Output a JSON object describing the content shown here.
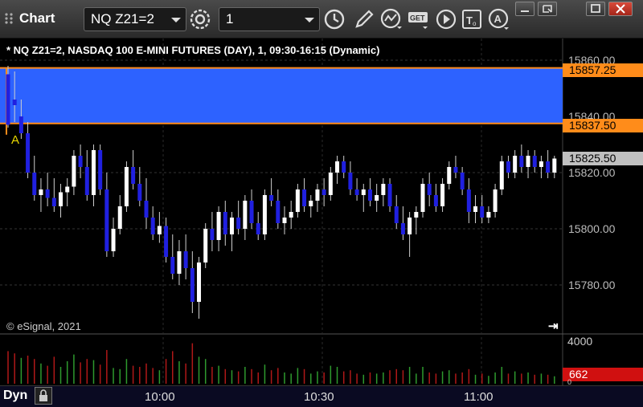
{
  "app": {
    "title": "Chart"
  },
  "toolbar": {
    "symbol": "NQ Z21=2",
    "interval": "1",
    "icons": [
      "settings-gear-icon",
      "clock-icon",
      "pencil-icon",
      "study-icon",
      "get-icon",
      "play-icon",
      "text-tool-icon",
      "alert-icon"
    ],
    "get_label": "GET"
  },
  "chart": {
    "header": "* NQ Z21=2, NASDAQ 100 E-MINI FUTURES (DAY), 1, 09:30-16:15 (Dynamic)",
    "watermark": "© eSignal, 2021",
    "marker_label": "A",
    "price_axis": [
      "15860.00",
      "15840.00",
      "15820.00",
      "15800.00",
      "15780.00"
    ],
    "zone_upper": "15857.25",
    "zone_lower": "15837.50",
    "last_price": "15825.50",
    "volume_axis_top": "4000",
    "volume_last": "662",
    "volume_axis_bottom": "0",
    "time_labels": [
      "10:00",
      "10:30",
      "11:00"
    ],
    "mode": "Dyn",
    "colors": {
      "zone": "#2d62ff",
      "zone_line": "#ff8c1a",
      "up_candle": "#ffffff",
      "down_candle": "#2020e0",
      "volume_up": "#2e9a2e",
      "volume_down": "#b01818",
      "last_price_flag": "#c0c0c0",
      "volume_flag": "#d01010"
    }
  },
  "chart_data": {
    "type": "candlestick",
    "ylim": [
      15765,
      15865
    ],
    "candles": [
      [
        15855,
        15858,
        15836,
        15837
      ],
      [
        15846,
        15856,
        15838,
        15844
      ],
      [
        15840,
        15846,
        15832,
        15834
      ],
      [
        15834,
        15838,
        15818,
        15820
      ],
      [
        15820,
        15826,
        15810,
        15812
      ],
      [
        15812,
        15818,
        15806,
        15814
      ],
      [
        15814,
        15820,
        15808,
        15811
      ],
      [
        15811,
        15818,
        15806,
        15808
      ],
      [
        15808,
        15816,
        15804,
        15813
      ],
      [
        15813,
        15818,
        15808,
        15815
      ],
      [
        15815,
        15828,
        15812,
        15826
      ],
      [
        15826,
        15830,
        15818,
        15822
      ],
      [
        15822,
        15828,
        15810,
        15812
      ],
      [
        15812,
        15830,
        15808,
        15828
      ],
      [
        15828,
        15830,
        15812,
        15814
      ],
      [
        15814,
        15820,
        15790,
        15792
      ],
      [
        15792,
        15804,
        15790,
        15800
      ],
      [
        15800,
        15812,
        15798,
        15808
      ],
      [
        15808,
        15824,
        15806,
        15822
      ],
      [
        15822,
        15828,
        15814,
        15816
      ],
      [
        15816,
        15822,
        15808,
        15810
      ],
      [
        15810,
        15818,
        15800,
        15804
      ],
      [
        15804,
        15808,
        15796,
        15798
      ],
      [
        15798,
        15806,
        15795,
        15801
      ],
      [
        15801,
        15804,
        15788,
        15790
      ],
      [
        15790,
        15798,
        15782,
        15784
      ],
      [
        15784,
        15796,
        15780,
        15792
      ],
      [
        15792,
        15798,
        15782,
        15786
      ],
      [
        15786,
        15792,
        15770,
        15774
      ],
      [
        15774,
        15790,
        15768,
        15788
      ],
      [
        15788,
        15802,
        15786,
        15800
      ],
      [
        15800,
        15806,
        15792,
        15796
      ],
      [
        15796,
        15808,
        15792,
        15806
      ],
      [
        15806,
        15810,
        15794,
        15798
      ],
      [
        15798,
        15806,
        15792,
        15804
      ],
      [
        15804,
        15810,
        15798,
        15800
      ],
      [
        15800,
        15812,
        15796,
        15810
      ],
      [
        15810,
        15814,
        15800,
        15802
      ],
      [
        15802,
        15806,
        15796,
        15798
      ],
      [
        15798,
        15814,
        15796,
        15812
      ],
      [
        15812,
        15818,
        15808,
        15810
      ],
      [
        15810,
        15814,
        15800,
        15802
      ],
      [
        15802,
        15808,
        15798,
        15804
      ],
      [
        15804,
        15810,
        15800,
        15806
      ],
      [
        15806,
        15816,
        15804,
        15814
      ],
      [
        15814,
        15818,
        15806,
        15808
      ],
      [
        15808,
        15812,
        15804,
        15810
      ],
      [
        15810,
        15816,
        15806,
        15814
      ],
      [
        15814,
        15818,
        15808,
        15812
      ],
      [
        15812,
        15822,
        15810,
        15820
      ],
      [
        15820,
        15826,
        15816,
        15824
      ],
      [
        15824,
        15826,
        15818,
        15820
      ],
      [
        15820,
        15824,
        15812,
        15814
      ],
      [
        15814,
        15818,
        15810,
        15812
      ],
      [
        15812,
        15816,
        15806,
        15814
      ],
      [
        15814,
        15818,
        15808,
        15810
      ],
      [
        15810,
        15816,
        15806,
        15812
      ],
      [
        15812,
        15818,
        15808,
        15816
      ],
      [
        15816,
        15818,
        15806,
        15808
      ],
      [
        15808,
        15812,
        15800,
        15802
      ],
      [
        15802,
        15808,
        15796,
        15798
      ],
      [
        15798,
        15806,
        15790,
        15804
      ],
      [
        15804,
        15808,
        15798,
        15806
      ],
      [
        15806,
        15818,
        15804,
        15816
      ],
      [
        15816,
        15820,
        15808,
        15812
      ],
      [
        15812,
        15816,
        15806,
        15808
      ],
      [
        15808,
        15818,
        15806,
        15816
      ],
      [
        15816,
        15824,
        15814,
        15822
      ],
      [
        15822,
        15826,
        15818,
        15820
      ],
      [
        15820,
        15822,
        15812,
        15814
      ],
      [
        15814,
        15818,
        15802,
        15806
      ],
      [
        15806,
        15812,
        15802,
        15808
      ],
      [
        15808,
        15812,
        15802,
        15804
      ],
      [
        15804,
        15808,
        15802,
        15806
      ],
      [
        15806,
        15816,
        15804,
        15814
      ],
      [
        15814,
        15826,
        15812,
        15824
      ],
      [
        15824,
        15826,
        15818,
        15820
      ],
      [
        15820,
        15828,
        15818,
        15826
      ],
      [
        15826,
        15830,
        15820,
        15822
      ],
      [
        15822,
        15828,
        15818,
        15826
      ],
      [
        15826,
        15828,
        15820,
        15822
      ],
      [
        15822,
        15826,
        15818,
        15824
      ],
      [
        15824,
        15828,
        15818,
        15820
      ],
      [
        15820,
        15826,
        15818,
        15825
      ]
    ],
    "volume": [
      [
        2900,
        "d"
      ],
      [
        2700,
        "d"
      ],
      [
        2300,
        "u"
      ],
      [
        2500,
        "d"
      ],
      [
        2200,
        "d"
      ],
      [
        1800,
        "u"
      ],
      [
        1600,
        "d"
      ],
      [
        2400,
        "d"
      ],
      [
        1500,
        "u"
      ],
      [
        2000,
        "u"
      ],
      [
        2600,
        "u"
      ],
      [
        1900,
        "d"
      ],
      [
        2200,
        "d"
      ],
      [
        2100,
        "u"
      ],
      [
        1700,
        "d"
      ],
      [
        3000,
        "d"
      ],
      [
        1400,
        "u"
      ],
      [
        1300,
        "u"
      ],
      [
        2200,
        "u"
      ],
      [
        1600,
        "d"
      ],
      [
        1500,
        "d"
      ],
      [
        1800,
        "d"
      ],
      [
        1400,
        "d"
      ],
      [
        1200,
        "u"
      ],
      [
        2200,
        "d"
      ],
      [
        2900,
        "d"
      ],
      [
        2000,
        "u"
      ],
      [
        1800,
        "d"
      ],
      [
        3600,
        "d"
      ],
      [
        2400,
        "u"
      ],
      [
        2200,
        "u"
      ],
      [
        1500,
        "d"
      ],
      [
        1600,
        "u"
      ],
      [
        1300,
        "d"
      ],
      [
        1200,
        "u"
      ],
      [
        1100,
        "d"
      ],
      [
        1500,
        "u"
      ],
      [
        1300,
        "d"
      ],
      [
        1000,
        "d"
      ],
      [
        1700,
        "u"
      ],
      [
        1200,
        "d"
      ],
      [
        1400,
        "d"
      ],
      [
        1000,
        "u"
      ],
      [
        900,
        "u"
      ],
      [
        1400,
        "u"
      ],
      [
        1300,
        "d"
      ],
      [
        900,
        "u"
      ],
      [
        1100,
        "u"
      ],
      [
        1000,
        "d"
      ],
      [
        1600,
        "u"
      ],
      [
        1500,
        "u"
      ],
      [
        1100,
        "d"
      ],
      [
        1200,
        "d"
      ],
      [
        900,
        "d"
      ],
      [
        800,
        "u"
      ],
      [
        1000,
        "d"
      ],
      [
        900,
        "u"
      ],
      [
        1000,
        "u"
      ],
      [
        1200,
        "d"
      ],
      [
        1300,
        "d"
      ],
      [
        1200,
        "d"
      ],
      [
        1500,
        "u"
      ],
      [
        900,
        "u"
      ],
      [
        1500,
        "u"
      ],
      [
        1000,
        "d"
      ],
      [
        900,
        "d"
      ],
      [
        1100,
        "u"
      ],
      [
        1200,
        "u"
      ],
      [
        900,
        "d"
      ],
      [
        1000,
        "d"
      ],
      [
        1300,
        "d"
      ],
      [
        800,
        "u"
      ],
      [
        900,
        "d"
      ],
      [
        700,
        "u"
      ],
      [
        1000,
        "u"
      ],
      [
        1500,
        "u"
      ],
      [
        900,
        "d"
      ],
      [
        1100,
        "u"
      ],
      [
        900,
        "d"
      ],
      [
        1000,
        "u"
      ],
      [
        800,
        "d"
      ],
      [
        900,
        "u"
      ],
      [
        800,
        "d"
      ],
      [
        662,
        "u"
      ]
    ]
  }
}
